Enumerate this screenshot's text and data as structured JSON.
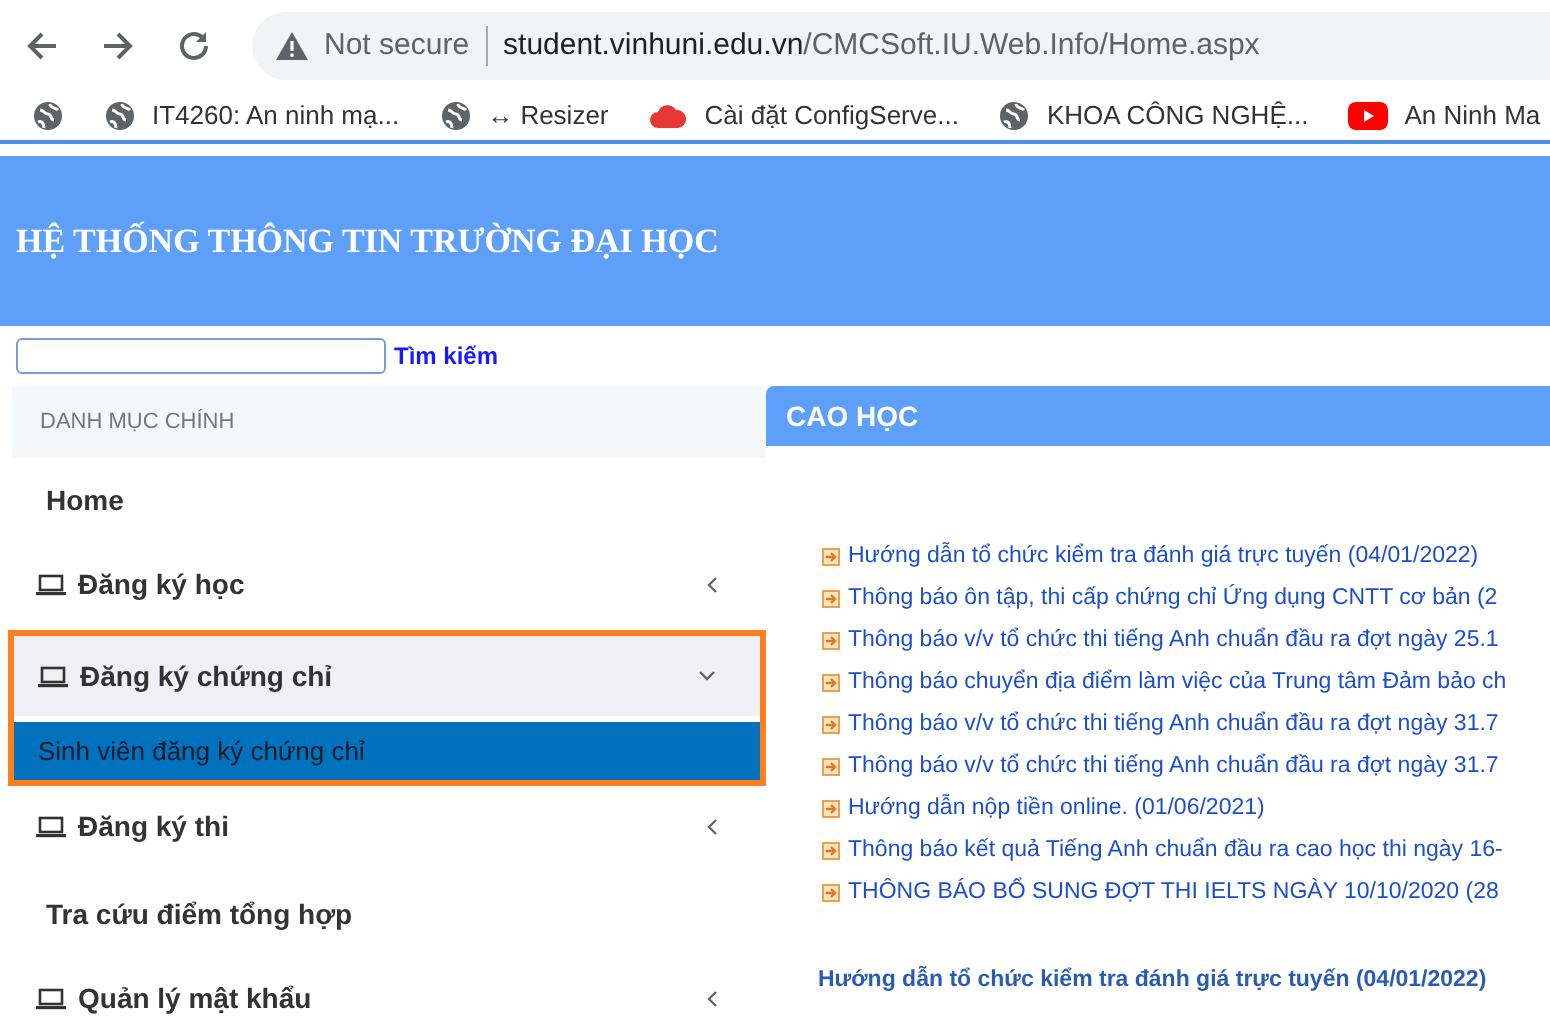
{
  "browser": {
    "security": "Not secure",
    "url_host": "student.vinhuni.edu.vn",
    "url_path": "/CMCSoft.IU.Web.Info/Home.aspx"
  },
  "bookmarks": [
    {
      "kind": "globe"
    },
    {
      "kind": "globe",
      "label": "IT4260: An ninh mạ..."
    },
    {
      "kind": "globe",
      "label": "↔ Resizer"
    },
    {
      "kind": "cloud",
      "label": "Cài đặt ConfigServe..."
    },
    {
      "kind": "globe",
      "label": "KHOA CÔNG NGHỆ..."
    },
    {
      "kind": "video",
      "label": "An Ninh Ma"
    }
  ],
  "header": {
    "title": "HỆ THỐNG THÔNG TIN TRƯỜNG ĐẠI HỌC"
  },
  "search": {
    "button": "Tìm kiếm"
  },
  "sidebar": {
    "title": "DANH MỤC CHÍNH",
    "items": [
      {
        "label": "Home",
        "kind": "link"
      },
      {
        "label": "Đăng ký học",
        "kind": "group",
        "expanded": false,
        "highlighted": false
      },
      {
        "label": "Đăng ký chứng chỉ",
        "kind": "group",
        "expanded": true,
        "highlighted": true,
        "children": [
          {
            "label": "Sinh viên đăng ký chứng chỉ",
            "selected": true
          }
        ]
      },
      {
        "label": "Đăng ký thi",
        "kind": "group",
        "expanded": false,
        "highlighted": false
      },
      {
        "label": "Tra cứu điểm tổng hợp",
        "kind": "link"
      },
      {
        "label": "Quản lý mật khẩu",
        "kind": "group",
        "expanded": false,
        "highlighted": false
      }
    ]
  },
  "panel": {
    "title": "CAO HỌC",
    "news": [
      "Hướng dẫn tổ chức kiểm tra đánh giá trực tuyến (04/01/2022)",
      "Thông báo ôn tập, thi cấp chứng chỉ Ứng dụng CNTT cơ bản (2",
      "Thông báo v/v tổ chức thi tiếng Anh chuẩn đầu ra đợt ngày 25.1",
      "Thông báo chuyển địa điểm làm việc của Trung tâm Đảm bảo ch",
      "Thông báo v/v tổ chức thi tiếng Anh chuẩn đầu ra đợt ngày 31.7",
      "Thông báo v/v tổ chức thi tiếng Anh chuẩn đầu ra đợt ngày 31.7",
      "Hướng dẫn nộp tiền online. (01/06/2021)",
      "Thông báo kết quả Tiếng Anh chuẩn đầu ra cao học thi ngày 16-",
      "THÔNG BÁO BỔ SUNG ĐỢT THI IELTS NGÀY 10/10/2020 (28"
    ],
    "featured": "Hướng dẫn tổ chức kiểm tra đánh giá trực tuyến (04/01/2022)"
  }
}
